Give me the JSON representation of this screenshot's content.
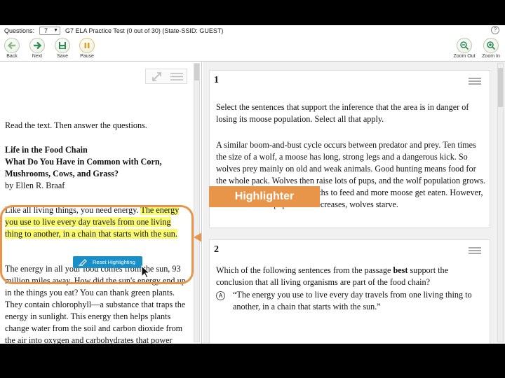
{
  "header": {
    "questions_label": "Questions:",
    "question_number": "7",
    "test_title": "G7 ELA Practice Test (0 out of 30)  (State-SSID: GUEST)",
    "help": "?"
  },
  "toolbar": {
    "back": "Back",
    "next": "Next",
    "save": "Save",
    "pause": "Pause",
    "zoom_out": "Zoom Out",
    "zoom_in": "Zoom In"
  },
  "passage": {
    "instructions": "Read the text. Then answer the questions.",
    "title1": "Life in the Food Chain",
    "title2": "What Do You Have in Common with Corn, Mushrooms, Cows, and Grass?",
    "byline": "by Ellen R. Braaf",
    "p1_plain": "Like all living things, you need energy. ",
    "p1_highlighted": "The energy you use to live every day travels from one living thing to another, in a chain that starts with the sun.",
    "p2": "The energy in all your food comes from the sun, 93 million miles away. How did the sun's energy end up in the things you eat? You can thank green plants. They contain chlorophyll—a substance that traps the energy in sunlight. This energy then helps plants change water from the soil and carbon dioxide from the air into oxygen and carbohydrates that power their cells. This process is called",
    "reset_button": "Reset Highlighting"
  },
  "callout": {
    "label": "Highlighter",
    "color": "#e8954a"
  },
  "questions": [
    {
      "number": "1",
      "prompt": "Select the sentences that support the inference that the area is in danger of losing its moose population. Select all that apply.",
      "passage_excerpt": "A similar boom-and-bust cycle occurs between predator and prey. Ten times the size of a wolf, a moose has long, strong legs and a dangerous kick. So wolves prey mainly on old and weak animals. Good hunting means food for the whole pack. Wolves then raise lots of pups, and the wolf population grows. More wolves mean more mouths to feed and more moose get eaten. However, when the moose population decreases, wolves starve."
    },
    {
      "number": "2",
      "prompt_before": "Which of the following sentences from the passage ",
      "prompt_bold": "best",
      "prompt_after": " support the conclusion that all living organisms are part of the food chain?",
      "option_a_letter": "A",
      "option_a": "“The energy you use to live every day travels from one living thing to another, in a chain that starts with the sun.”"
    }
  ],
  "colors": {
    "highlight": "#fafa6e",
    "reset_button": "#1a8fc7",
    "toolbar_icon": "#2e8b57"
  }
}
